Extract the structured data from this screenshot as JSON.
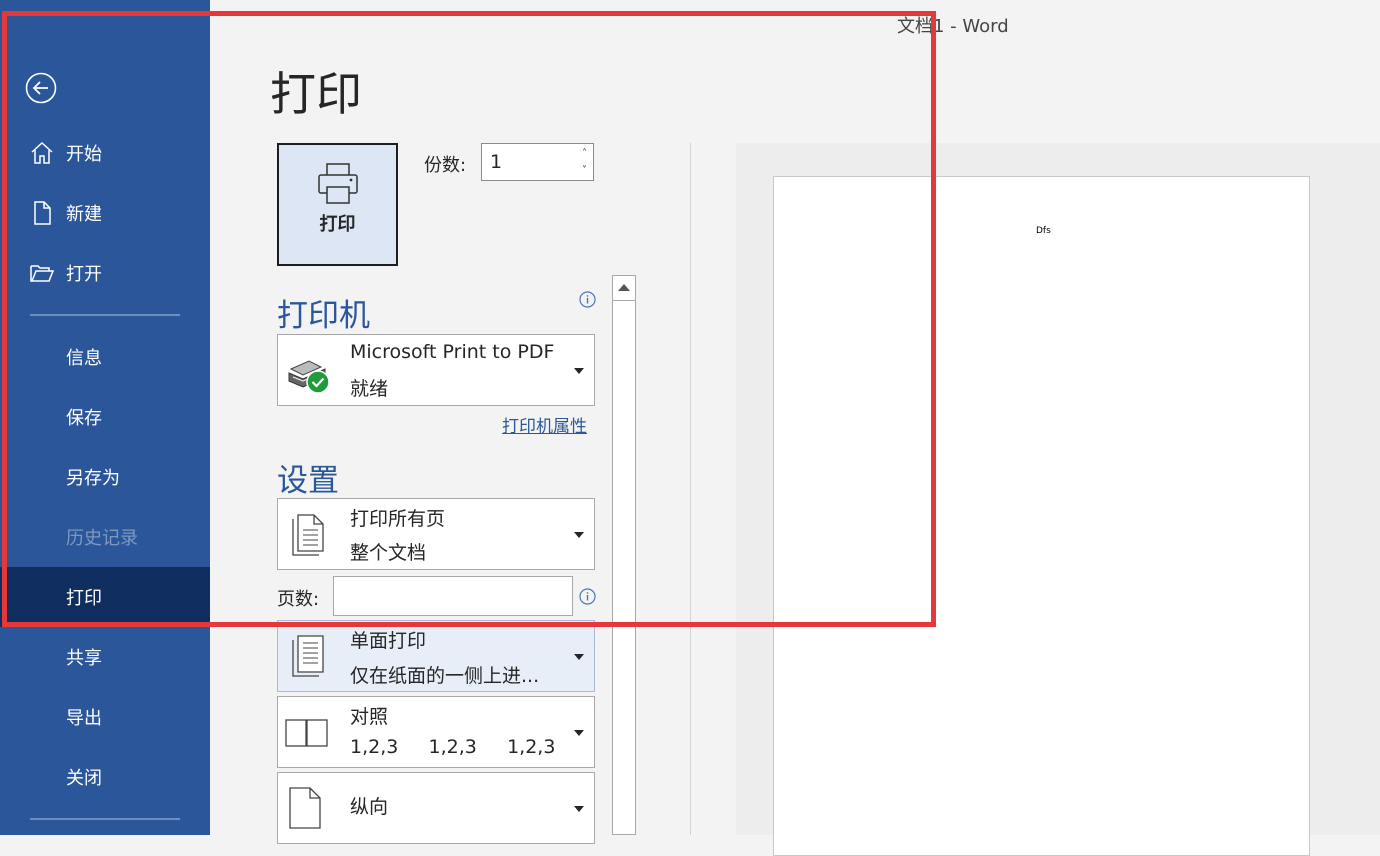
{
  "window": {
    "title": "文档1  -  Word"
  },
  "sidebar": {
    "back_icon": "back-arrow-icon",
    "items": [
      {
        "label": "开始",
        "icon": "home-icon",
        "state": "normal"
      },
      {
        "label": "新建",
        "icon": "new-doc-icon",
        "state": "normal"
      },
      {
        "label": "打开",
        "icon": "folder-open-icon",
        "state": "normal"
      },
      {
        "label": "信息",
        "state": "normal"
      },
      {
        "label": "保存",
        "state": "normal"
      },
      {
        "label": "另存为",
        "state": "normal"
      },
      {
        "label": "历史记录",
        "state": "disabled"
      },
      {
        "label": "打印",
        "state": "active"
      },
      {
        "label": "共享",
        "state": "normal"
      },
      {
        "label": "导出",
        "state": "normal"
      },
      {
        "label": "关闭",
        "state": "normal"
      }
    ]
  },
  "main": {
    "title": "打印",
    "print_button_label": "打印",
    "copies": {
      "label": "份数:",
      "value": "1"
    },
    "printer": {
      "heading": "打印机",
      "name": "Microsoft Print to PDF",
      "status": "就绪",
      "properties_link": "打印机属性"
    },
    "settings": {
      "heading": "设置",
      "range": {
        "line1": "打印所有页",
        "line2": "整个文档"
      },
      "pages_label": "页数:",
      "pages_value": "",
      "sides": {
        "line1": "单面打印",
        "line2": "仅在纸面的一侧上进..."
      },
      "collate": {
        "line1": "对照",
        "line2": "1,2,3     1,2,3     1,2,3"
      },
      "orientation": {
        "line1": "纵向"
      }
    }
  },
  "preview": {
    "text": "Dfs"
  },
  "colors": {
    "sidebar": "#2b579a",
    "sidebar_active": "#0f2d5e",
    "accent": "#2b579a",
    "annotation": "#e5383b"
  }
}
